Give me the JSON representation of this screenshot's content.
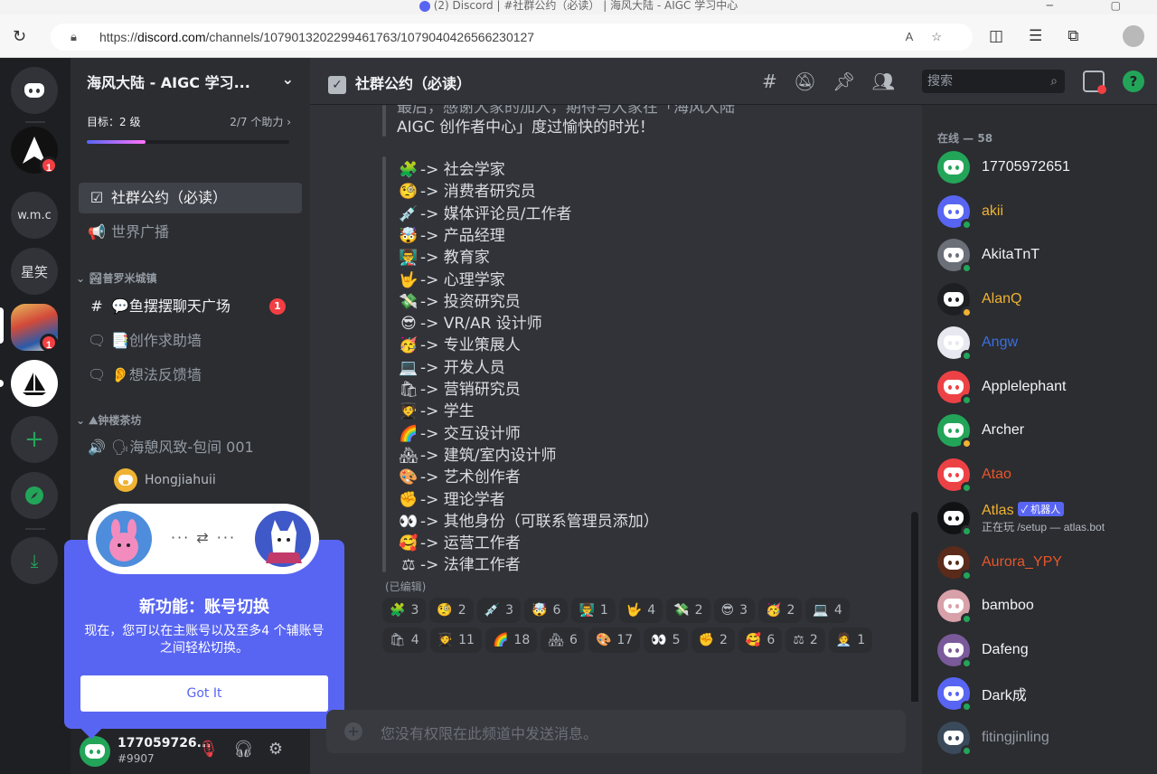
{
  "browser": {
    "title": "(2) Discord | #社群公约（必读） | 海风大陆 - AIGC 学习中心",
    "url_prefix": "https://",
    "url_domain": "discord.com",
    "url_path": "/channels/1079013202299461763/1079040426566230127"
  },
  "rail": {
    "servers": [
      {
        "label": "",
        "badge": ""
      },
      {
        "label": "",
        "badge": "1"
      },
      {
        "label": "w.m.c",
        "badge": ""
      },
      {
        "label": "星笑",
        "badge": ""
      },
      {
        "label": "",
        "badge": "1"
      },
      {
        "label": "",
        "badge": ""
      }
    ]
  },
  "sidebar": {
    "server_name": "海风大陆 - AIGC 学习...",
    "boost_goal": "目标：2 级",
    "boost_count": "2/7 个助力 ›",
    "boost_fraction": 0.29,
    "channels": [
      {
        "icon": "☑",
        "label": "社群公约（必读）"
      },
      {
        "icon": "📢",
        "label": "世界广播"
      }
    ],
    "category1": "⌄ 🏞普罗米城镇",
    "channels2": [
      {
        "icon": "#",
        "label": "💬鱼摆摆聊天广场",
        "badge": "1"
      },
      {
        "icon": "🗨",
        "label": "📑创作求助墙"
      },
      {
        "icon": "🗨",
        "label": "👂想法反馈墙"
      }
    ],
    "category2": "⌄ ⛰钟楼茶坊",
    "voice_channel": {
      "icon": "🔊",
      "label": "🗣海憩风致-包间 001"
    },
    "voice_user": "Hongjiahuii"
  },
  "user": {
    "name": "177059726...",
    "tag": "#9907"
  },
  "popup": {
    "title": "新功能：账号切换",
    "desc": "现在，您可以在主账号以及至多4 个辅账号之间轻松切换。",
    "button": "Got It",
    "connector": "··· ⇄ ···"
  },
  "channel": {
    "name": "社群公约（必读）",
    "search_placeholder": "搜索"
  },
  "messages": {
    "intro_line1": "最后，感谢大家的加入，期待与大家在「海风大陆",
    "intro_line2": "AIGC 创作者中心」度过愉快的时光！",
    "roles": [
      {
        "emoji": "🧩",
        "text": "-> 社会学家"
      },
      {
        "emoji": "🧐",
        "text": "-> 消费者研究员"
      },
      {
        "emoji": "💉",
        "text": "-> 媒体评论员/工作者"
      },
      {
        "emoji": "🤯",
        "text": "-> 产品经理"
      },
      {
        "emoji": "👨‍🏫",
        "text": "-> 教育家"
      },
      {
        "emoji": "🤟",
        "text": "-> 心理学家"
      },
      {
        "emoji": "💸",
        "text": "-> 投资研究员"
      },
      {
        "emoji": "😎",
        "text": "-> VR/AR 设计师"
      },
      {
        "emoji": "🥳",
        "text": "-> 专业策展人"
      },
      {
        "emoji": "💻",
        "text": "-> 开发人员"
      },
      {
        "emoji": "🛍",
        "text": "-> 营销研究员"
      },
      {
        "emoji": "🧑‍🎓",
        "text": "-> 学生"
      },
      {
        "emoji": "🌈",
        "text": "-> 交互设计师"
      },
      {
        "emoji": "🏘",
        "text": "-> 建筑/室内设计师"
      },
      {
        "emoji": "🎨",
        "text": "-> 艺术创作者"
      },
      {
        "emoji": "✊",
        "text": "-> 理论学者"
      },
      {
        "emoji": "👀",
        "text": "-> 其他身份（可联系管理员添加）"
      },
      {
        "emoji": "🥰",
        "text": "-> 运营工作者"
      },
      {
        "emoji": "⚖",
        "text": "-> 法律工作者"
      }
    ],
    "edited": "(已编辑)",
    "reactions": [
      {
        "emoji": "🧩",
        "count": "3"
      },
      {
        "emoji": "🧐",
        "count": "2"
      },
      {
        "emoji": "💉",
        "count": "3"
      },
      {
        "emoji": "🤯",
        "count": "6"
      },
      {
        "emoji": "👨‍🏫",
        "count": "1"
      },
      {
        "emoji": "🤟",
        "count": "4"
      },
      {
        "emoji": "💸",
        "count": "2"
      },
      {
        "emoji": "😎",
        "count": "3"
      },
      {
        "emoji": "🥳",
        "count": "2"
      },
      {
        "emoji": "💻",
        "count": "4"
      },
      {
        "emoji": "🛍",
        "count": "4"
      },
      {
        "emoji": "🧑‍🎓",
        "count": "11"
      },
      {
        "emoji": "🌈",
        "count": "18"
      },
      {
        "emoji": "🏘",
        "count": "6"
      },
      {
        "emoji": "🎨",
        "count": "17"
      },
      {
        "emoji": "👀",
        "count": "5"
      },
      {
        "emoji": "✊",
        "count": "2"
      },
      {
        "emoji": "🥰",
        "count": "6"
      },
      {
        "emoji": "⚖",
        "count": "2"
      },
      {
        "emoji": "🧑‍💼",
        "count": "1"
      }
    ],
    "composer_placeholder": "您没有权限在此频道中发送消息。"
  },
  "members": {
    "header": "在线 — 58",
    "list": [
      {
        "name": "17705972651",
        "color": "#f2f3f5",
        "avatar": "#23a559",
        "status": ""
      },
      {
        "name": "akii",
        "color": "#f0b232",
        "avatar": "#5865f2",
        "status": "online"
      },
      {
        "name": "AkitaTnT",
        "color": "#f2f3f5",
        "avatar": "#6b6f78",
        "status": "online"
      },
      {
        "name": "AlanQ",
        "color": "#f0b232",
        "avatar": "#1e1f22",
        "status": "idle"
      },
      {
        "name": "Angw",
        "color": "#3b6fe0",
        "avatar": "#e8e8f0",
        "status": "online"
      },
      {
        "name": "Applelephant",
        "color": "#f2f3f5",
        "avatar": "#ed4245",
        "status": "online"
      },
      {
        "name": "Archer",
        "color": "#f2f3f5",
        "avatar": "#23a559",
        "status": "idle"
      },
      {
        "name": "Atao",
        "color": "#e8562a",
        "avatar": "#ed4245",
        "status": "online"
      },
      {
        "name": "Atlas",
        "color": "#f0b232",
        "avatar": "#111214",
        "status": "online",
        "bot": "✓ 机器人",
        "activity": "正在玩 /setup — atlas.bot"
      },
      {
        "name": "Aurora_YPY",
        "color": "#e8562a",
        "avatar": "#5a2a1a",
        "status": "online"
      },
      {
        "name": "bamboo",
        "color": "#f2f3f5",
        "avatar": "#d8a0a8",
        "status": "online"
      },
      {
        "name": "Dafeng",
        "color": "#f2f3f5",
        "avatar": "#7a5a9a",
        "status": "online"
      },
      {
        "name": "Dark成",
        "color": "#f2f3f5",
        "avatar": "#5865f2",
        "status": "online"
      },
      {
        "name": "fitingjinling",
        "color": "#949ba4",
        "avatar": "#3a4a5a",
        "status": "online"
      }
    ]
  }
}
